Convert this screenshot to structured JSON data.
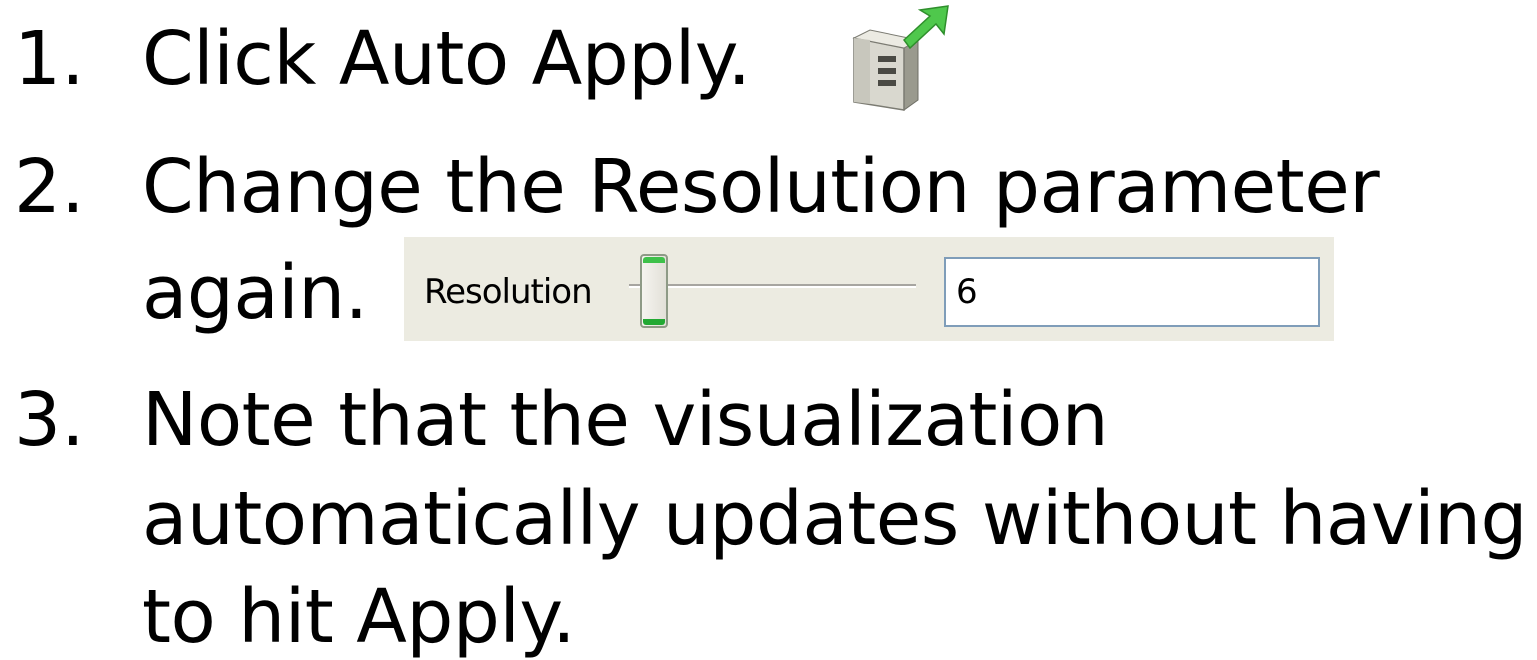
{
  "steps": [
    {
      "number": "1.",
      "lines": [
        "Click Auto Apply."
      ],
      "icon": "auto-apply-icon"
    },
    {
      "number": "2.",
      "lines": [
        "Change the Resolution parameter",
        "again."
      ]
    },
    {
      "number": "3.",
      "lines": [
        "Note that the visualization",
        "automatically updates without having",
        "to hit Apply."
      ]
    }
  ],
  "resolution_widget": {
    "label": "Resolution",
    "value": "6",
    "slider_level": 0.0
  },
  "colors": {
    "panel_background": "#ecebe1",
    "input_border": "#7f9db9",
    "slider_thumb_accent": "#3ec14a",
    "icon_arrow": "#3ec14a"
  }
}
